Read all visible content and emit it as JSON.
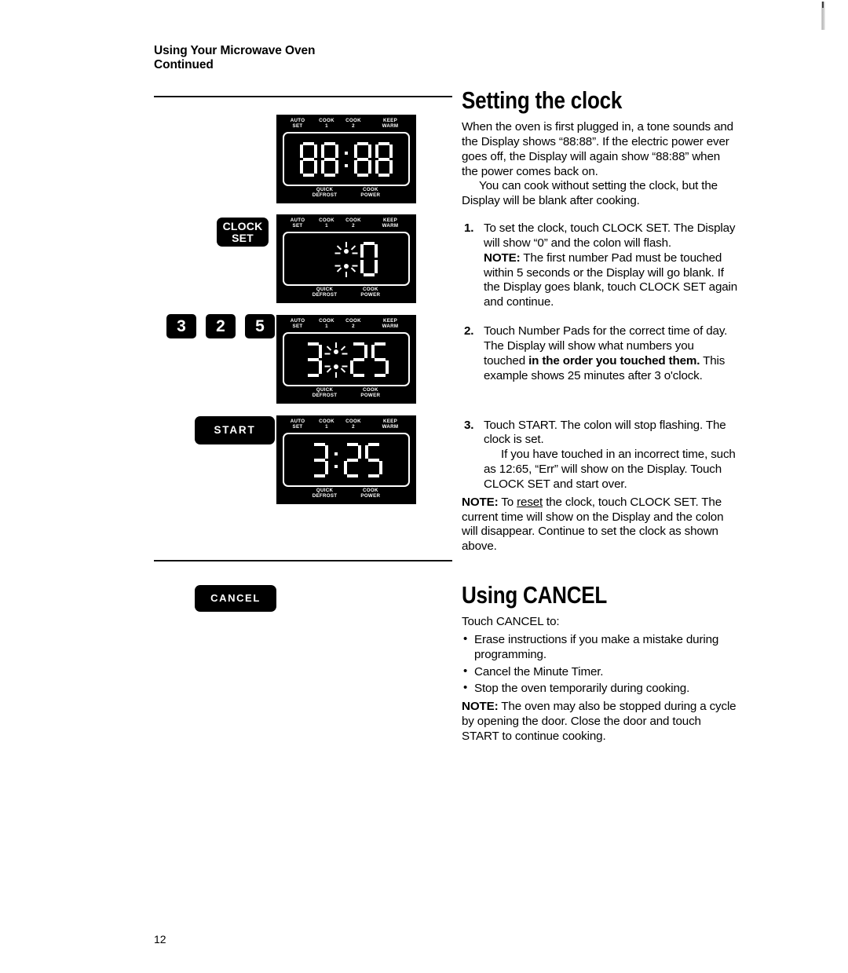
{
  "running_head": {
    "line1": "Using Your Microwave Oven",
    "line2": "Continued"
  },
  "page_number": "12",
  "panel_labels": {
    "auto_set": "AUTO\nSET",
    "cook_1": "COOK\n1",
    "cook_2": "COOK\n2",
    "keep_warm": "KEEP\nWARM",
    "quick_defrost": "QUICK\nDEFROST",
    "cook_power": "COOK\nPOWER"
  },
  "controls": {
    "clock_set": "CLOCK\nSET",
    "start": "START",
    "cancel": "CANCEL",
    "num_3": "3",
    "num_2": "2",
    "num_5": "5"
  },
  "displays": [
    {
      "name": "display-8888",
      "value": "88:88",
      "colon": "steady"
    },
    {
      "name": "display-zero",
      "value": "0",
      "colon": "flashing"
    },
    {
      "name": "display-325-flashing",
      "value": "3:25",
      "colon": "flashing"
    },
    {
      "name": "display-325-steady",
      "value": "3:25",
      "colon": "steady"
    }
  ],
  "setting_clock": {
    "heading": "Setting the clock",
    "intro_p1": "When the oven is first plugged in, a tone sounds and the Display shows “88:88”. If the electric power ever goes off, the Display will again show “88:88” when the power comes back on.",
    "intro_p2": "You can cook without setting the clock, but the Display will be blank after cooking.",
    "steps": [
      {
        "num": "1.",
        "text": "To set the clock, touch CLOCK SET. The Display will show “0” and the colon will flash.",
        "note_label": "NOTE:",
        "note_text": " The first number Pad must be touched within 5 seconds or the Display will go blank. If the Display goes blank, touch CLOCK SET again and continue."
      },
      {
        "num": "2.",
        "text_before": "Touch Number Pads for the correct time of day. The Display will show what numbers you touched ",
        "text_bold": "in the order you touched them.",
        "text_after": " This example shows 25 minutes after 3 o'clock."
      },
      {
        "num": "3.",
        "text": "Touch START. The colon will stop flashing. The clock is set.",
        "sub_text": "If you have touched in an incorrect time, such as 12:65, “Err” will show on the Display. Touch CLOCK SET and start over."
      }
    ],
    "final_note": {
      "label": "NOTE:",
      "before": " To ",
      "underlined": "reset",
      "after": " the clock, touch CLOCK SET. The current time will show on the Display and the colon will disappear. Continue to set the clock as shown above."
    }
  },
  "using_cancel": {
    "heading": "Using CANCEL",
    "intro": "Touch CANCEL to:",
    "bullets": [
      "Erase instructions if you make a mistake during programming.",
      "Cancel the Minute Timer.",
      "Stop the oven temporarily during cooking."
    ],
    "note_label": "NOTE:",
    "note_text": " The oven may also be stopped during a cycle by opening the door. Close the door and touch START to continue cooking."
  }
}
